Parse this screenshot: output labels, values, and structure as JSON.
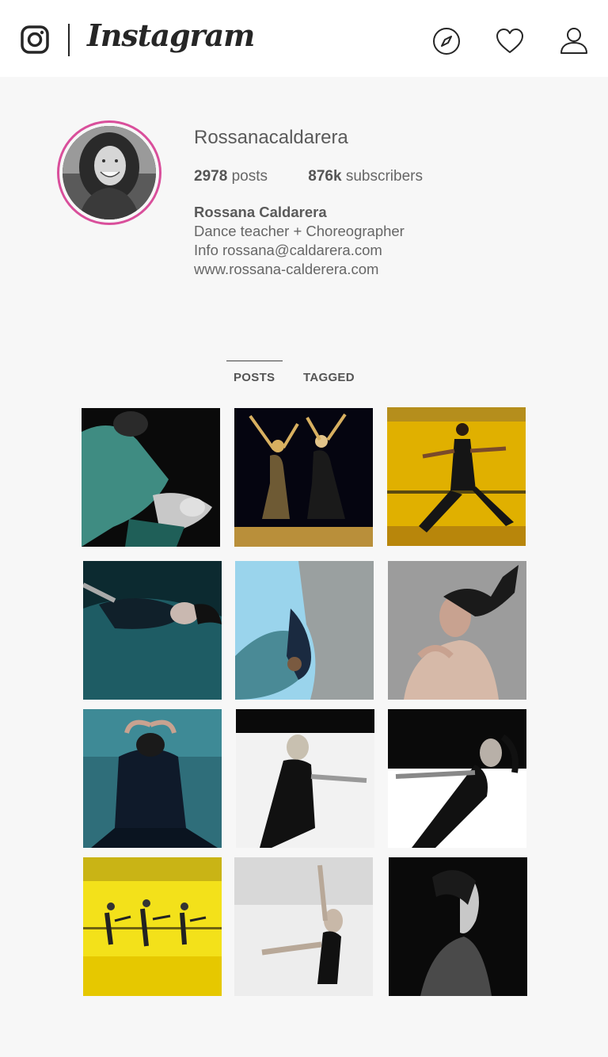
{
  "app": {
    "wordmark": "Instagram"
  },
  "header": {
    "icons": [
      "instagram-logo-icon",
      "compass-icon",
      "heart-icon",
      "user-icon"
    ]
  },
  "profile": {
    "username": "Rossanacaldarera",
    "posts_count": "2978",
    "posts_label": "posts",
    "subscribers_count": "876k",
    "subscribers_label": "subscribers",
    "full_name": "Rossana Caldarera",
    "bio_line_1": "Dance teacher + Choreographer",
    "bio_line_2": "Info rossana@caldarera.com",
    "website": "www.rossana-calderera.com"
  },
  "tabs": [
    {
      "label": "POSTS",
      "active": true
    },
    {
      "label": "TAGGED",
      "active": false
    }
  ],
  "colors": {
    "avatar_ring": "#d94f9b",
    "header_bg": "#ffffff",
    "page_bg": "#f7f7f7"
  }
}
